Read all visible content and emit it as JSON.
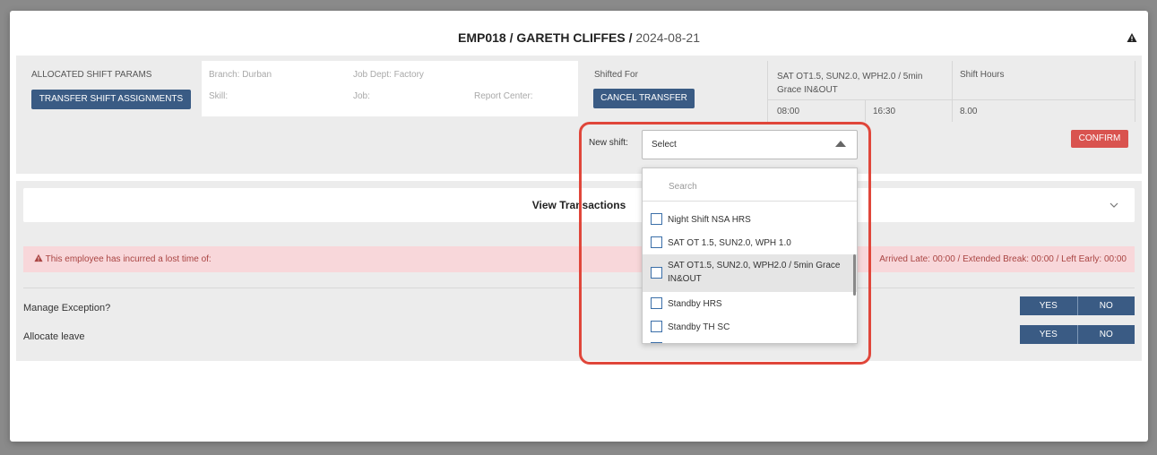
{
  "header": {
    "employee": "EMP018 / GARETH CLIFFES /",
    "date": " 2024-08-21"
  },
  "params": {
    "allocated_label": "ALLOCATED SHIFT PARAMS",
    "transfer_button": "TRANSFER SHIFT ASSIGNMENTS",
    "branch": "Branch: Durban",
    "job_dept": "Job Dept: Factory",
    "skill": "Skill:",
    "job": "Job:",
    "report_center": "Report Center:",
    "shifted_for": "Shifted For",
    "cancel_transfer_button": "CANCEL TRANSFER",
    "shift_name": "SAT OT1.5, SUN2.0, WPH2.0 / 5min Grace IN&OUT",
    "shift_hours_label": "Shift Hours",
    "start_time": "08:00",
    "end_time": "16:30",
    "hours": "8.00",
    "confirm_button": "CONFIRM"
  },
  "new_shift": {
    "label": "New shift:",
    "selected": "Select",
    "search_placeholder": "Search",
    "options": [
      "Night Shift NSA HRS",
      "SAT OT 1.5, SUN2.0, WPH 1.0",
      "SAT OT1.5, SUN2.0, WPH2.0 / 5min Grace IN&OUT",
      "Standby HRS",
      "Standby TH SC"
    ]
  },
  "transactions": {
    "title": "View Transactions"
  },
  "alert": {
    "left_text": "This employee has incurred a lost time of:",
    "right_text": "Arrived Late: 00:00 / Extended Break: 00:00 / Left Early: 00:00"
  },
  "exceptions": {
    "manage_label": "Manage Exception?",
    "allocate_label": "Allocate leave",
    "yes": "YES",
    "no": "NO"
  },
  "colors": {
    "primary_button": "#3a5b84",
    "confirm_button": "#d9534f",
    "alert_background": "#f8d7da",
    "highlight_ring": "#e0463a"
  }
}
